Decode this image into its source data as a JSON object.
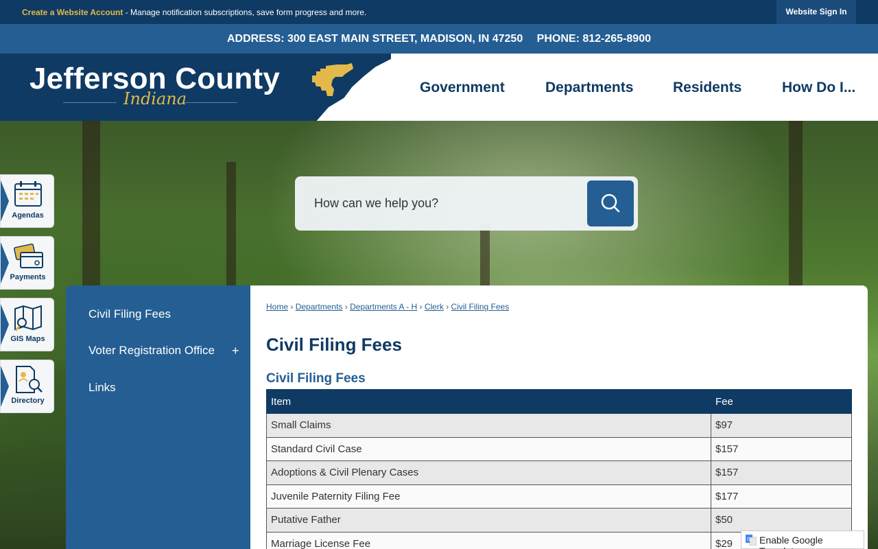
{
  "topbar": {
    "account_link": "Create a Website Account",
    "account_text": " - Manage notification subscriptions, save form progress and more.",
    "signin": "Website Sign In"
  },
  "address_bar": {
    "address": "ADDRESS: 300 EAST MAIN STREET, MADISON, IN 47250",
    "phone": "PHONE: 812-265-8900"
  },
  "logo": {
    "title": "Jefferson County",
    "subtitle": "Indiana"
  },
  "nav": [
    "Government",
    "Departments",
    "Residents",
    "How Do I..."
  ],
  "search": {
    "placeholder": "How can we help you?"
  },
  "quick_links": [
    "Agendas",
    "Payments",
    "GIS Maps",
    "Directory"
  ],
  "sidebar": {
    "items": [
      "Civil Filing Fees",
      "Voter Registration Office",
      "Links"
    ],
    "expand_symbol": "+"
  },
  "breadcrumb": [
    "Home",
    "Departments",
    "Departments A - H",
    "Clerk",
    "Civil Filing Fees"
  ],
  "breadcrumb_sep": "›",
  "page_title": "Civil Filing Fees",
  "section_title": "Civil Filing Fees",
  "table": {
    "headers": [
      "Item",
      "Fee"
    ],
    "rows": [
      [
        "Small Claims",
        "$97"
      ],
      [
        "Standard Civil Case",
        "$157"
      ],
      [
        "Adoptions & Civil Plenary Cases",
        "$157"
      ],
      [
        "Juvenile Paternity Filing Fee",
        "$177"
      ],
      [
        "Putative Father",
        "$50"
      ],
      [
        "Marriage License Fee",
        "$29"
      ]
    ]
  },
  "translate": {
    "label": "Enable Google Translate"
  },
  "colors": {
    "navy": "#0f3a63",
    "blue": "#245e93",
    "gold": "#e3b94b"
  },
  "icons": [
    "calendar-icon",
    "payment-card-icon",
    "map-icon",
    "directory-icon",
    "search-icon",
    "google-icon"
  ]
}
